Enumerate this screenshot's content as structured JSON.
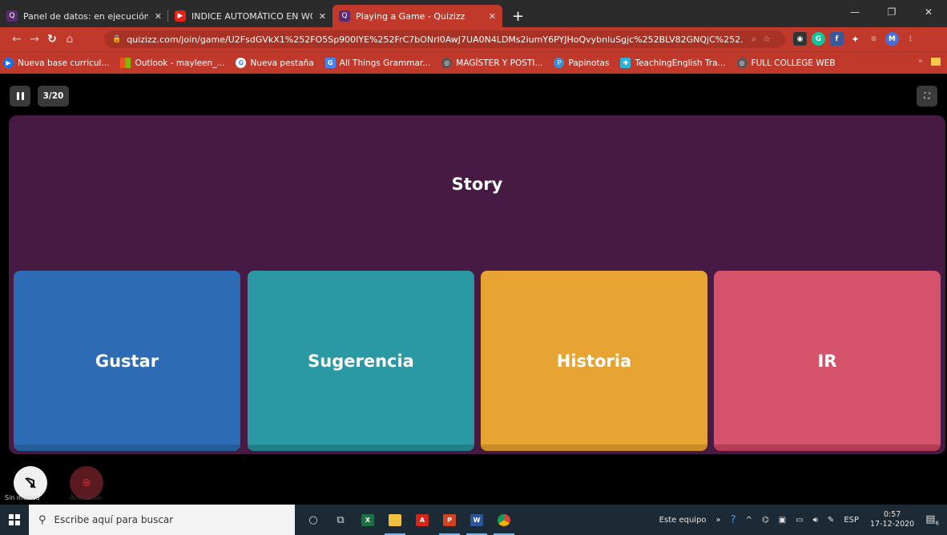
{
  "tabs": [
    {
      "title": "Panel de datos: en ejecución",
      "favicon": "Q",
      "favicon_color": "#5a2a73",
      "active": false
    },
    {
      "title": "INDICE AUTOMÁTICO EN WORD",
      "favicon": "▶",
      "favicon_color": "#e62117",
      "active": false
    },
    {
      "title": "Playing a Game - Quizizz",
      "favicon": "Q",
      "favicon_color": "#5a2a73",
      "active": true
    }
  ],
  "address": {
    "url": "quizizz.com/join/game/U2FsdGVkX1%252FO5Sp900IYE%252FrC7bONrl0AwJ7UA0N4LDMs2iumY6PYJHoQvybnluSgjc%252BLV82GNQjC%252..."
  },
  "bookmarks": [
    {
      "label": "Nueva base curricul...",
      "icon": "play-circle-icon",
      "color": "#1a73e8"
    },
    {
      "label": "Outlook - mayleen_...",
      "icon": "windows-icon",
      "color": "#f25022"
    },
    {
      "label": "Nueva pestaña",
      "icon": "google-icon",
      "color": "#ffffff"
    },
    {
      "label": "All Things Grammar...",
      "icon": "google-icon",
      "color": "#4285f4"
    },
    {
      "label": "MAGÍSTER Y POSTI...",
      "icon": "globe-icon",
      "color": "#555555"
    },
    {
      "label": "Papinotas",
      "icon": "papinotas-icon",
      "color": "#3b8fd8"
    },
    {
      "label": "TeachingEnglish Tra...",
      "icon": "teaching-icon",
      "color": "#2bb3d8"
    },
    {
      "label": "FULL COLLEGE WEB",
      "icon": "globe-icon",
      "color": "#555555"
    }
  ],
  "bookmarks_more": "»",
  "game": {
    "counter": "3/20",
    "question": "Story",
    "options": [
      {
        "label": "Gustar",
        "color": "#2d6cb4",
        "shade": "#255c9a"
      },
      {
        "label": "Sugerencia",
        "color": "#2b99a3",
        "shade": "#22808a"
      },
      {
        "label": "Historia",
        "color": "#e8a433",
        "shade": "#c98b25"
      },
      {
        "label": "IR",
        "color": "#d4526a",
        "shade": "#b43d55"
      }
    ],
    "music_label": "Sin música",
    "zoom_label": "Acercarse"
  },
  "taskbar": {
    "search_placeholder": "Escribe aquí para buscar",
    "tray_label": "Este equipo",
    "language": "ESP",
    "time": "0:57",
    "date": "17-12-2020",
    "notifications": "6"
  },
  "colors": {
    "browser_accent": "#c0392b",
    "question_panel": "#461a42"
  }
}
